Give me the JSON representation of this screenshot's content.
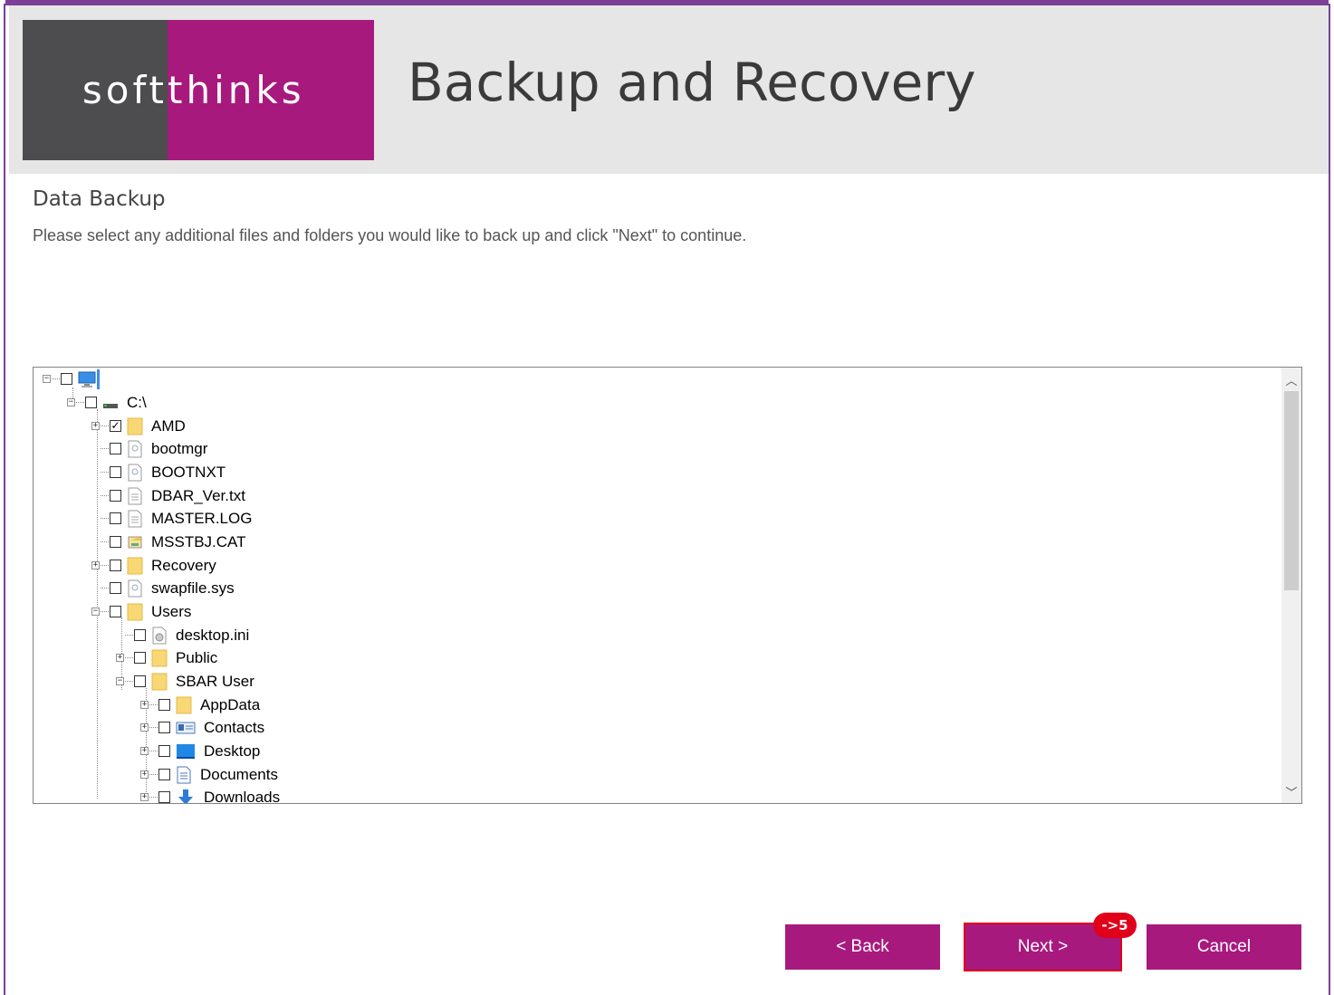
{
  "header": {
    "logo_left": "soft",
    "logo_right": "thinks",
    "title": "Backup and Recovery"
  },
  "page": {
    "heading": "Data Backup",
    "instructions": "Please select any additional files and folders you would like to back up and click \"Next\" to continue."
  },
  "tree": {
    "root": {
      "label": "",
      "icon": "computer-icon",
      "checked": false
    },
    "items": [
      {
        "label": "C:\\",
        "icon": "drive-icon",
        "checked": false,
        "expanded": true
      },
      {
        "label": "AMD",
        "icon": "folder-icon",
        "checked": true,
        "expanded": false
      },
      {
        "label": "bootmgr",
        "icon": "system-file-icon",
        "checked": false
      },
      {
        "label": "BOOTNXT",
        "icon": "system-file-icon",
        "checked": false
      },
      {
        "label": "DBAR_Ver.txt",
        "icon": "text-file-icon",
        "checked": false
      },
      {
        "label": "MASTER.LOG",
        "icon": "text-file-icon",
        "checked": false
      },
      {
        "label": "MSSTBJ.CAT",
        "icon": "catalog-file-icon",
        "checked": false
      },
      {
        "label": "Recovery",
        "icon": "folder-icon",
        "checked": false,
        "expanded": false
      },
      {
        "label": "swapfile.sys",
        "icon": "system-file-icon",
        "checked": false
      },
      {
        "label": "Users",
        "icon": "folder-icon",
        "checked": false,
        "expanded": true
      },
      {
        "label": "desktop.ini",
        "icon": "settings-file-icon",
        "checked": false
      },
      {
        "label": "Public",
        "icon": "folder-icon",
        "checked": false,
        "expanded": false
      },
      {
        "label": "SBAR User",
        "icon": "folder-icon",
        "checked": false,
        "expanded": true
      },
      {
        "label": "AppData",
        "icon": "folder-icon",
        "checked": false,
        "expanded": false
      },
      {
        "label": "Contacts",
        "icon": "contacts-icon",
        "checked": false,
        "expanded": false
      },
      {
        "label": "Desktop",
        "icon": "desktop-icon",
        "checked": false,
        "expanded": false
      },
      {
        "label": "Documents",
        "icon": "documents-icon",
        "checked": false,
        "expanded": false
      },
      {
        "label": "Downloads",
        "icon": "downloads-icon",
        "checked": false,
        "expanded": false
      }
    ]
  },
  "buttons": {
    "back": "< Back",
    "next": "Next >",
    "cancel": "Cancel"
  },
  "annotation": {
    "badge": "->5"
  },
  "colors": {
    "brand_magenta": "#a8197e",
    "brand_gray": "#4d4d4f",
    "frame_purple": "#7b3f98",
    "highlight_red": "#e0001a"
  }
}
